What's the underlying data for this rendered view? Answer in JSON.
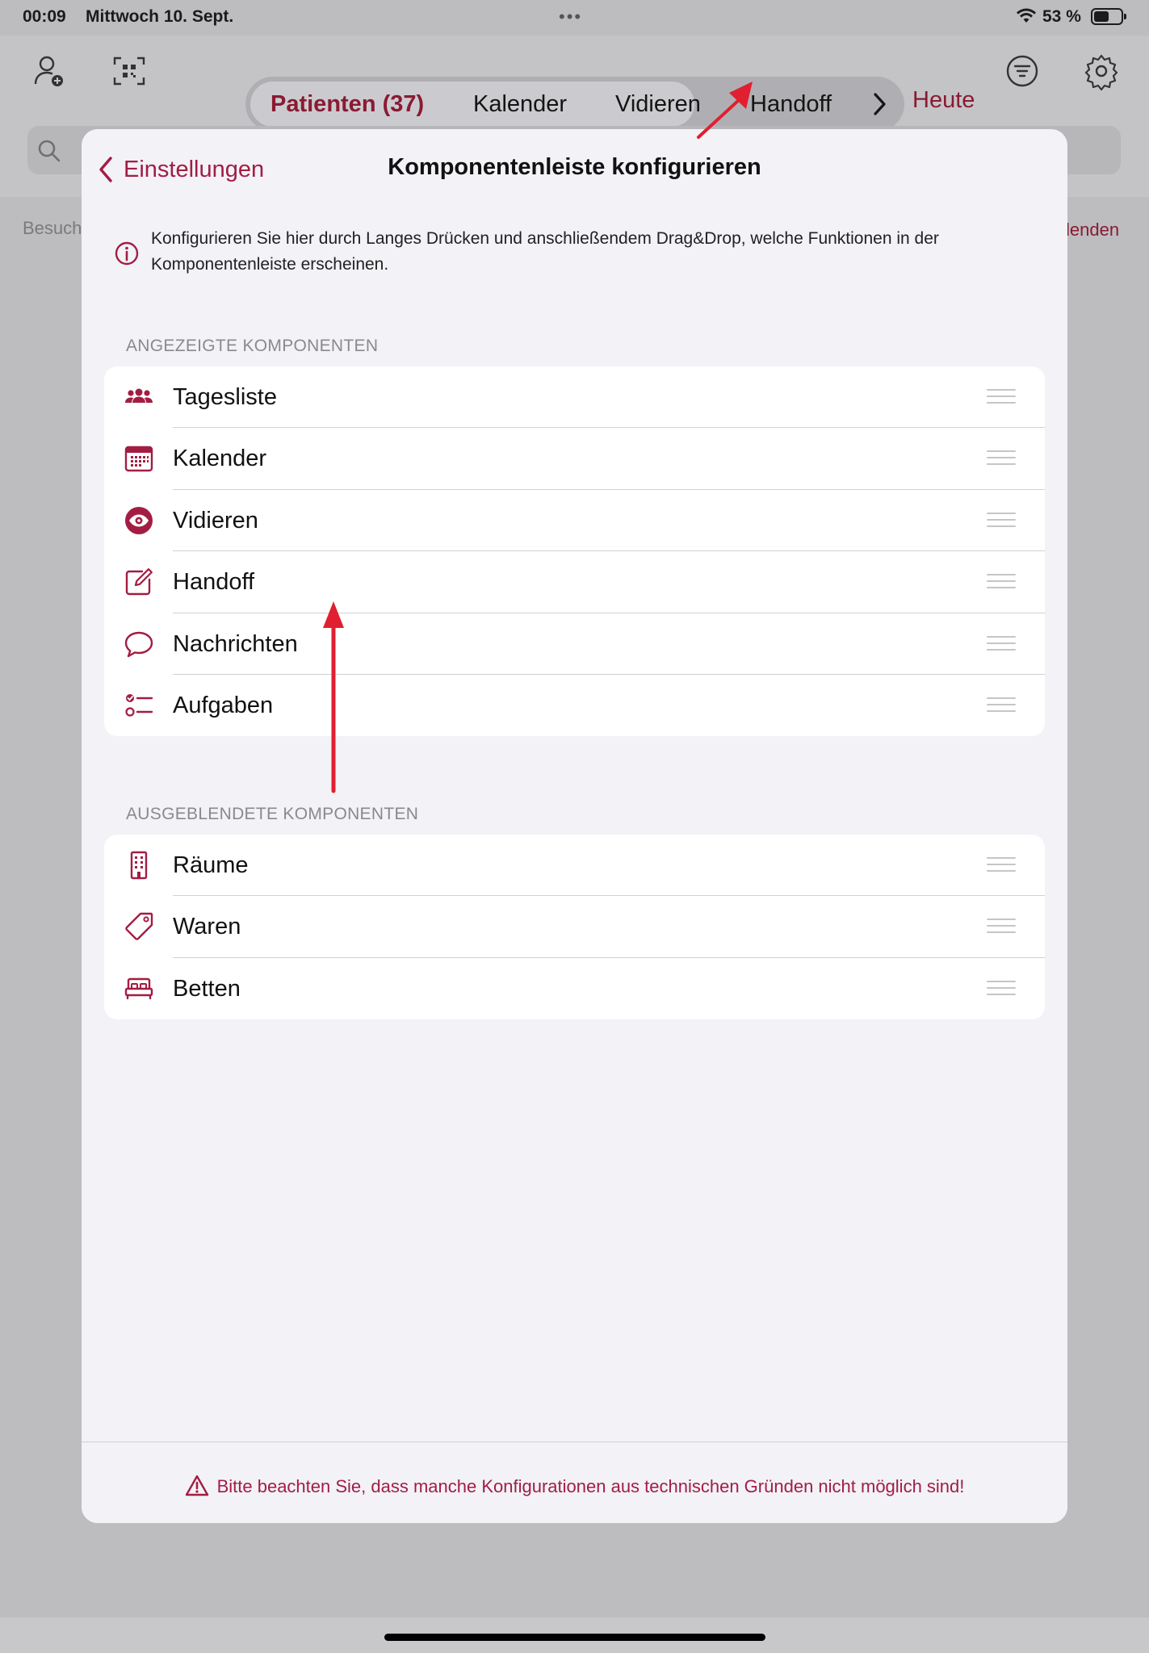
{
  "status_bar": {
    "time": "00:09",
    "date": "Mittwoch 10. Sept.",
    "battery": "53 %"
  },
  "toolbar": {
    "tabs": [
      {
        "label": "Patienten (37)",
        "selected": true
      },
      {
        "label": "Kalender",
        "selected": false
      },
      {
        "label": "Vidieren",
        "selected": false
      },
      {
        "label": "Handoff",
        "selected": false
      }
    ],
    "today_label": "Heute",
    "icons": [
      "add-patient-icon",
      "qr-scan-icon",
      "chevron-right-icon",
      "filter-icon",
      "gear-icon"
    ]
  },
  "background": {
    "left_text": "Besuch",
    "right_text": "lenden"
  },
  "sheet": {
    "back_label": "Einstellungen",
    "title": "Komponentenleiste konfigurieren",
    "info_text": "Konfigurieren Sie hier durch Langes Drücken und anschließendem Drag&Drop, welche Funktionen in der Komponentenleiste erscheinen.",
    "shown_section": {
      "header": "ANGEZEIGTE KOMPONENTEN",
      "items": [
        {
          "label": "Tagesliste",
          "icon": "people-icon"
        },
        {
          "label": "Kalender",
          "icon": "calendar-icon"
        },
        {
          "label": "Vidieren",
          "icon": "eye-icon"
        },
        {
          "label": "Handoff",
          "icon": "edit-icon"
        },
        {
          "label": "Nachrichten",
          "icon": "chat-bubble-icon"
        },
        {
          "label": "Aufgaben",
          "icon": "checklist-icon"
        }
      ]
    },
    "hidden_section": {
      "header": "AUSGEBLENDETE KOMPONENTEN",
      "items": [
        {
          "label": "Räume",
          "icon": "building-icon"
        },
        {
          "label": "Waren",
          "icon": "tag-icon"
        },
        {
          "label": "Betten",
          "icon": "bed-icon"
        }
      ]
    },
    "footer_warning": "Bitte beachten Sie, dass manche Konfigurationen aus technischen Gründen nicht möglich sind!"
  },
  "colors": {
    "accent": "#a31d43",
    "annotation_arrow": "#e02030"
  }
}
